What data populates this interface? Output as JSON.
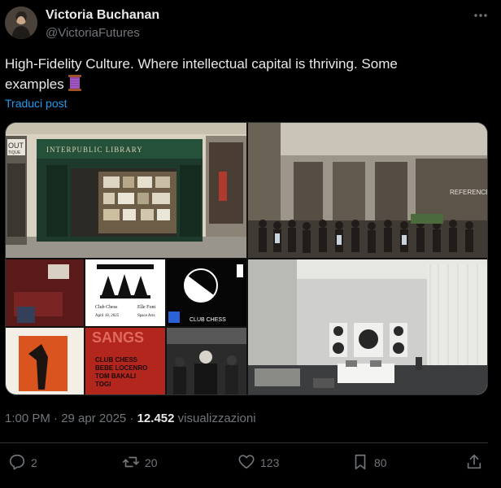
{
  "author": {
    "name": "Victoria Buchanan",
    "handle": "@VictoriaFutures"
  },
  "tweet": {
    "text": "High-Fidelity Culture. Where intellectual capital is thriving. Some examples",
    "emoji_icon": "thread-spool-emoji",
    "translate_label": "Traduci post"
  },
  "media": {
    "library_sign": "INTERPUBLIC LIBRARY",
    "shop_left_sign": "OUT",
    "shop_left_sub": "TIQUE",
    "reference_sign": "REFERENCE.PI",
    "poster_club_chess": "Club Chess",
    "poster_elle_front": "Elle Font",
    "poster_date": "April 18, 2025",
    "poster_place": "Space Arts",
    "club_chess_logo": "CLUB CHESS",
    "sangs_title": "SANGS",
    "sangs_line1": "CLUB CHESS",
    "sangs_line2": "BEBE LOCENRO",
    "sangs_line3": "TOM BAKALI",
    "sangs_line4": "TOGI"
  },
  "meta": {
    "time": "1:00 PM · 29 apr 2025 · ",
    "views_count": "12.452",
    "views_label": " visualizzazioni"
  },
  "actions": {
    "replies": "2",
    "reposts": "20",
    "likes": "123",
    "bookmarks": "80"
  },
  "colors": {
    "background": "#000000",
    "text": "#e7e9ea",
    "muted": "#71767b",
    "link": "#1d9bf0",
    "divider": "#2f3336"
  }
}
